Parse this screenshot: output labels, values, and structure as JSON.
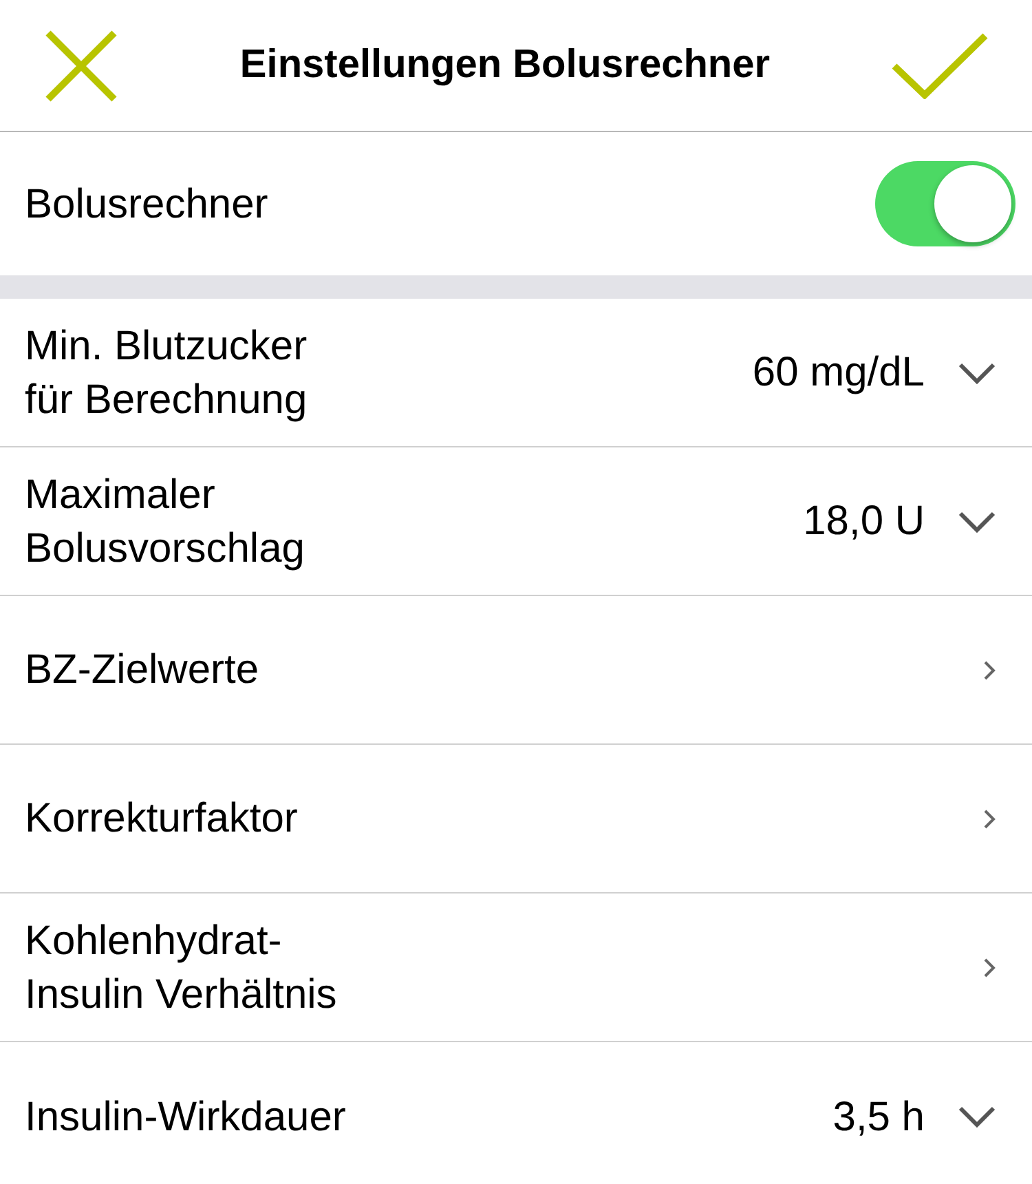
{
  "header": {
    "title": "Einstellungen Bolusrechner"
  },
  "toggle": {
    "label": "Bolusrechner",
    "on": true
  },
  "rows": [
    {
      "kind": "dropdown",
      "label": "Min. Blutzucker\nfür Berechnung",
      "value": "60 mg/dL"
    },
    {
      "kind": "dropdown",
      "label": "Maximaler\nBolusvorschlag",
      "value": "18,0 U"
    },
    {
      "kind": "link",
      "label": "BZ-Zielwerte"
    },
    {
      "kind": "link",
      "label": "Korrekturfaktor"
    },
    {
      "kind": "link",
      "label": "Kohlenhydrat-\nInsulin Verhältnis"
    },
    {
      "kind": "dropdown",
      "label": "Insulin-Wirkdauer",
      "value": "3,5 h"
    }
  ]
}
